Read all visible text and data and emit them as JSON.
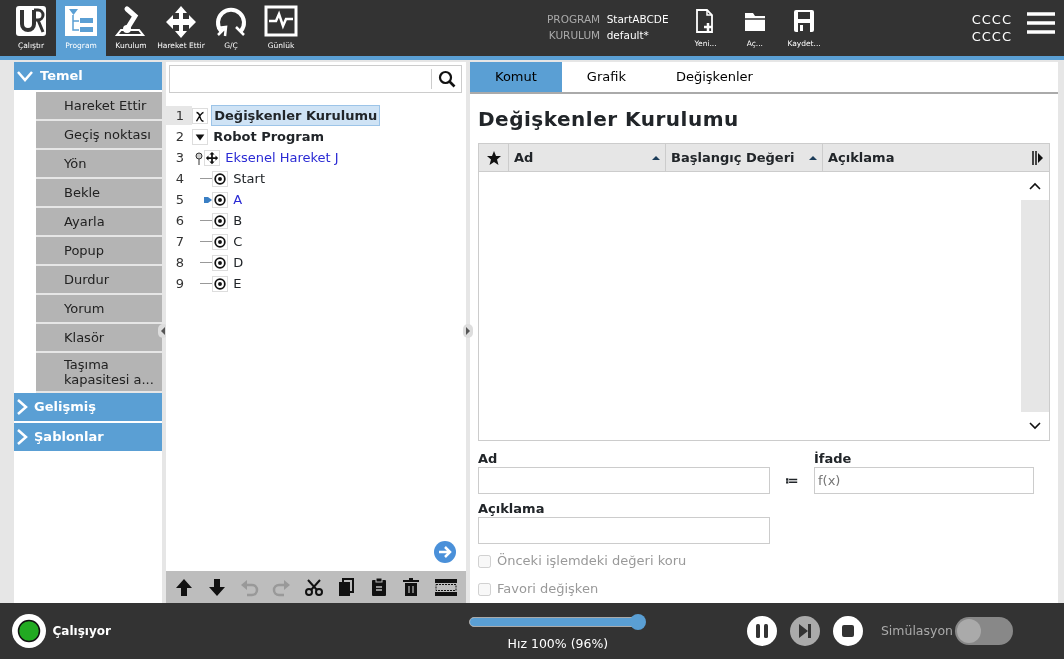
{
  "top_nav": [
    {
      "label": "Çalıştır",
      "kind": "logo",
      "selected": false
    },
    {
      "label": "Program",
      "kind": "program",
      "selected": true
    },
    {
      "label": "Kurulum",
      "kind": "robot",
      "selected": false
    },
    {
      "label": "Hareket Ettir",
      "kind": "move",
      "selected": false
    },
    {
      "label": "G/Ç",
      "kind": "io",
      "selected": false
    },
    {
      "label": "Günlük",
      "kind": "log",
      "selected": false
    }
  ],
  "program_info": {
    "program_label": "PROGRAM",
    "program_name": "StartABCDE",
    "installation_label": "KURULUM",
    "installation_name": "default*"
  },
  "file_buttons": [
    {
      "label": "Yeni...",
      "kind": "new"
    },
    {
      "label": "Aç...",
      "kind": "open"
    },
    {
      "label": "Kaydet...",
      "kind": "save"
    }
  ],
  "user": {
    "line_1": "CCCC",
    "line_2": "CCCC"
  },
  "sidebar": {
    "groups": [
      {
        "label": "Temel",
        "expanded": true,
        "items": [
          "Hareket Ettir",
          "Geçiş noktası",
          "Yön",
          "Bekle",
          "Ayarla",
          "Popup",
          "Durdur",
          "Yorum",
          "Klasör",
          "Taşıma kapasitesi a..."
        ]
      },
      {
        "label": "Gelişmiş",
        "expanded": false
      },
      {
        "label": "Şablonlar",
        "expanded": false
      }
    ]
  },
  "tree": {
    "nodes": [
      {
        "number": "1",
        "label": "Değişkenler Kurulumu",
        "kind": "variables",
        "selected": true,
        "active": false
      },
      {
        "number": "2",
        "label": "Robot Program",
        "kind": "program",
        "selected": false,
        "active": false,
        "expanded": true,
        "children": [
          {
            "number": "3",
            "label": "Eksenel Hareket J",
            "kind": "move",
            "selected": false,
            "active": true,
            "expanded": true,
            "children": [
              {
                "number": "4",
                "label": "Start",
                "kind": "waypoint",
                "selected": false,
                "active": false
              },
              {
                "number": "5",
                "label": "A",
                "kind": "waypoint",
                "selected": false,
                "active": true,
                "pointer": true
              },
              {
                "number": "6",
                "label": "B",
                "kind": "waypoint",
                "selected": false,
                "active": false
              },
              {
                "number": "7",
                "label": "C",
                "kind": "waypoint",
                "selected": false,
                "active": false
              },
              {
                "number": "8",
                "label": "D",
                "kind": "waypoint",
                "selected": false,
                "active": false
              },
              {
                "number": "9",
                "label": "E",
                "kind": "waypoint",
                "selected": false,
                "active": false
              }
            ]
          }
        ]
      }
    ],
    "toolbar": [
      {
        "kind": "up",
        "disabled": false
      },
      {
        "kind": "down",
        "disabled": false
      },
      {
        "kind": "undo",
        "disabled": true
      },
      {
        "kind": "redo",
        "disabled": true
      },
      {
        "kind": "cut",
        "disabled": false
      },
      {
        "kind": "copy",
        "disabled": false
      },
      {
        "kind": "paste",
        "disabled": false
      },
      {
        "kind": "delete",
        "disabled": false
      },
      {
        "kind": "suppress",
        "disabled": false
      }
    ]
  },
  "tabs": [
    {
      "label": "Komut",
      "selected": true
    },
    {
      "label": "Grafik",
      "selected": false
    },
    {
      "label": "Değişkenler",
      "selected": false
    }
  ],
  "title": "Değişkenler Kurulumu",
  "table": {
    "columns": [
      {
        "label": "Ad",
        "sortable": true
      },
      {
        "label": "Başlangıç Değeri",
        "sortable": true
      },
      {
        "label": "Açıklama",
        "sortable": false
      }
    ]
  },
  "form": {
    "name_label": "Ad",
    "assign": "≔",
    "expression_label": "İfade",
    "expression_placeholder": "f(x)",
    "description_label": "Açıklama",
    "checkboxes": [
      {
        "label": "Önceki işlemdeki değeri koru",
        "checked": false,
        "disabled": true
      },
      {
        "label": "Favori değişken",
        "checked": false,
        "disabled": true
      }
    ]
  },
  "status_bar": {
    "status": "Çalışıyor",
    "running": true,
    "speed": {
      "level": 1.0,
      "reading": "Hız 100% (96%)"
    },
    "simulation": {
      "label": "Simülasyon",
      "on": false
    }
  }
}
